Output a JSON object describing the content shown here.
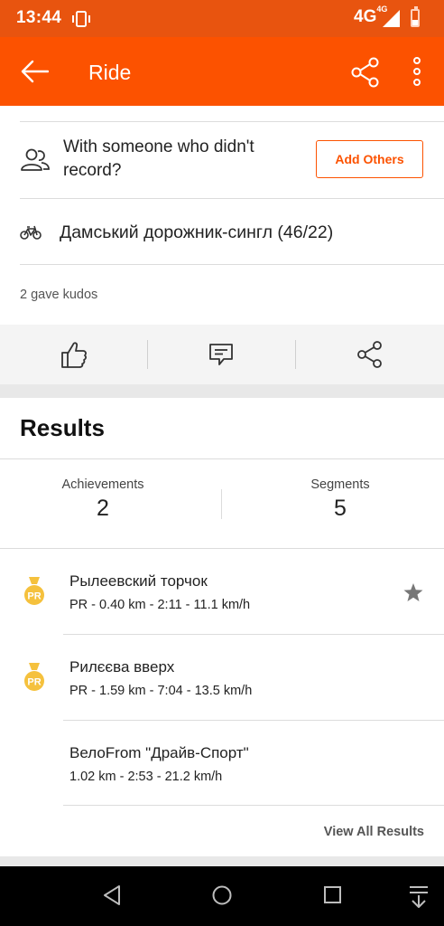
{
  "status_bar": {
    "time": "13:44",
    "network": "4G",
    "network_sup": "4G",
    "icons": [
      "vibrate-icon",
      "signal-icon",
      "battery-icon"
    ]
  },
  "app_bar": {
    "title": "Ride",
    "icons": [
      "back-arrow-icon",
      "share-icon",
      "more-vertical-icon"
    ]
  },
  "with_others": {
    "text": "With someone who didn't record?",
    "button": "Add Others"
  },
  "bike": {
    "name": "Дамський дорожник-сингл (46/22)"
  },
  "kudos": {
    "text": "2 gave kudos"
  },
  "actions": [
    "thumbs-up-icon",
    "comment-icon",
    "share-icon"
  ],
  "results": {
    "title": "Results",
    "stats": [
      {
        "label": "Achievements",
        "value": "2"
      },
      {
        "label": "Segments",
        "value": "5"
      }
    ],
    "segments": [
      {
        "name": "Рылеевский торчок",
        "detail": "PR - 0.40 km - 2:11 - 11.1 km/h",
        "medal": "PR",
        "starred": true
      },
      {
        "name": "Рилєєва вверх",
        "detail": "PR - 1.59 km - 7:04 - 13.5 km/h",
        "medal": "PR",
        "starred": false
      },
      {
        "name": "ВелоFrom \"Драйв-Спорт\"",
        "detail": "1.02 km - 2:53 - 21.2 km/h",
        "medal": "",
        "starred": false
      }
    ],
    "view_all": "View All Results"
  },
  "colors": {
    "brand": "#fc5200",
    "status_bar": "#e8540f",
    "medal": "#f5c13d"
  }
}
